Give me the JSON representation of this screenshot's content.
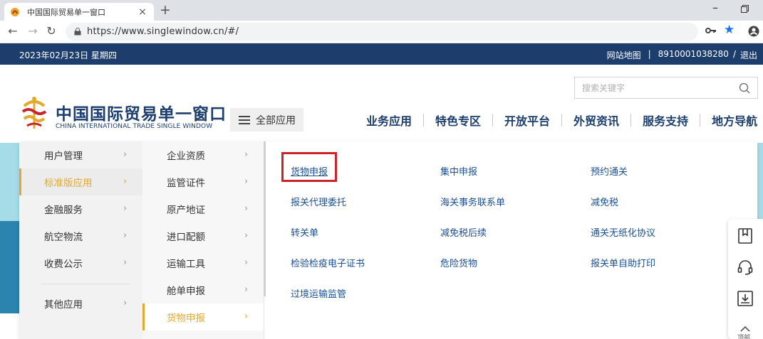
{
  "browser": {
    "tab_title": "中国国际贸易单一窗口",
    "tab_close": "×",
    "new_tab": "+",
    "minimize": "–",
    "url": "https://www.singlewindow.cn/#/",
    "back": "←",
    "forward": "→",
    "reload": "↻",
    "star": "★"
  },
  "topbar": {
    "date": "2023年02月23日 星期四",
    "sitemap": "网站地图",
    "sep1": "|",
    "account": "8910001038280",
    "sep2": "/",
    "logout": "退出"
  },
  "header": {
    "search_placeholder": "搜索关键字",
    "logo_cn": "中国国际贸易单一窗口",
    "logo_en": "CHINA INTERNATIONAL TRADE SINGLE WINDOW",
    "all_apps": "全部应用",
    "nav": [
      "业务应用",
      "特色专区",
      "开放平台",
      "外贸资讯",
      "服务支持",
      "地方导航"
    ]
  },
  "menu": {
    "col1": [
      "用户管理",
      "标准版应用",
      "金融服务",
      "航空物流",
      "收费公示",
      "其他应用"
    ],
    "col1_active": 1,
    "col2": [
      "企业资质",
      "监管证件",
      "原产地证",
      "进口配额",
      "运输工具",
      "舱单申报",
      "货物申报"
    ],
    "col2_active": 6,
    "chevron": "›",
    "links": [
      [
        "货物申报",
        "集中申报",
        "预约通关"
      ],
      [
        "报关代理委托",
        "海关事务联系单",
        "减免税"
      ],
      [
        "转关单",
        "减免税后续",
        "通关无纸化协议"
      ],
      [
        "检验检疫电子证书",
        "危险货物",
        "报关单自助打印"
      ],
      [
        "过境运输监管"
      ]
    ],
    "highlighted_link": "货物申报"
  },
  "side_toolbar": {
    "icons": [
      "bookmark-icon",
      "headset-icon",
      "download-icon",
      "back-to-top-icon"
    ],
    "top_label": "顶部"
  },
  "colors": {
    "navy": "#1d3e6d",
    "active_gold": "#e3a92c",
    "highlight_red": "#c8242b",
    "banner_light": "#a6dbe8",
    "banner_dark": "#2b84ae"
  }
}
